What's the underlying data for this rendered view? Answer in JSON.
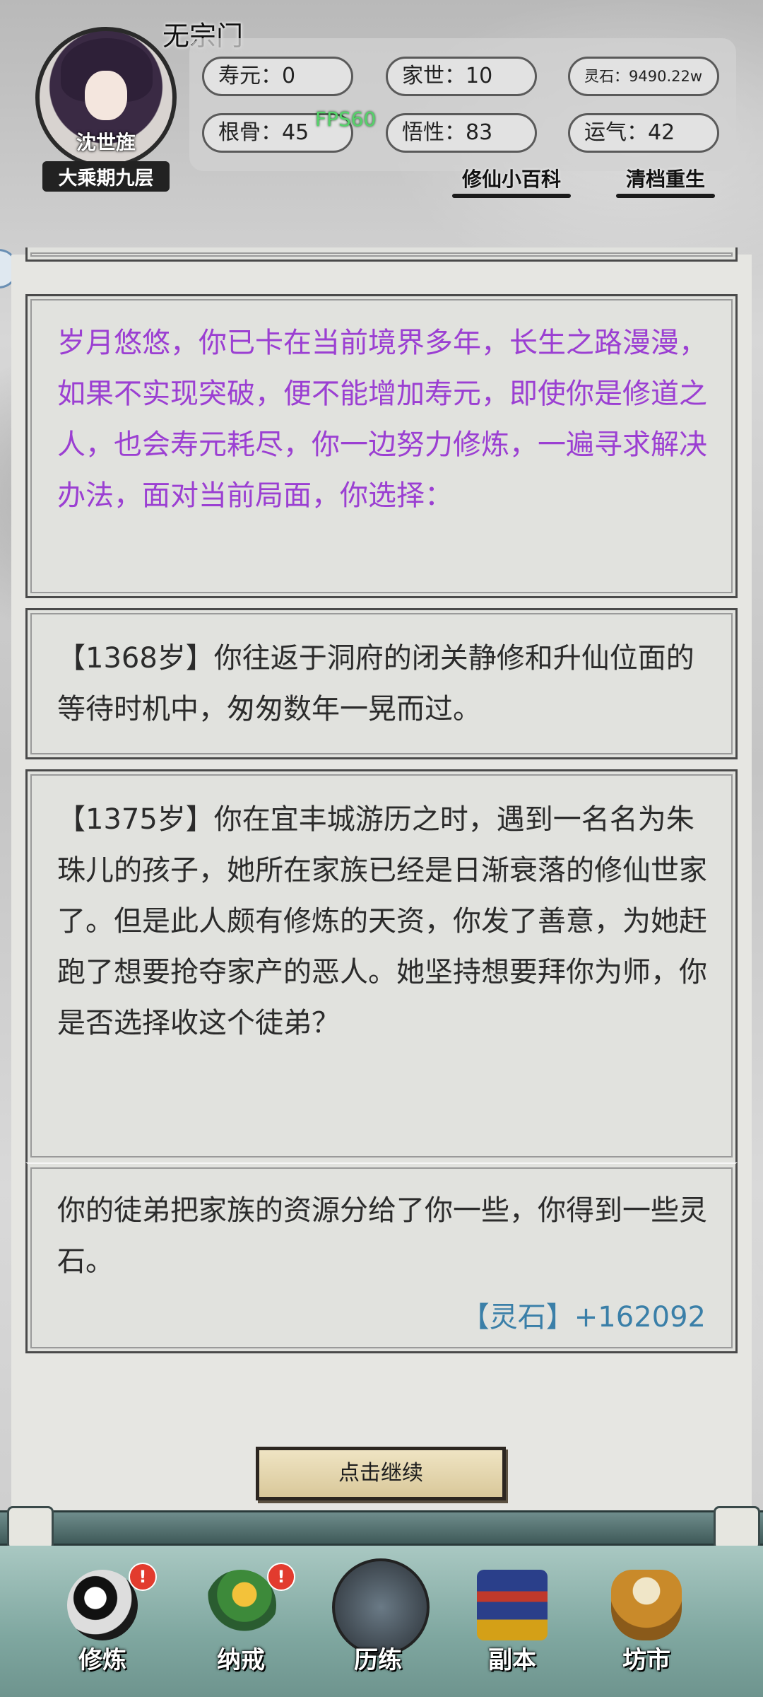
{
  "header": {
    "sect_name": "无宗门",
    "character_name": "沈世旌",
    "realm": "大乘期九层",
    "stats": {
      "lifespan": "寿元：0",
      "family": "家世：10",
      "spirit_stones": "灵石：9490.22w",
      "root_bone": "根骨：45",
      "comprehension": "悟性：83",
      "luck": "运气：42"
    },
    "links": {
      "encyclopedia": "修仙小百科",
      "rebirth": "清档重生"
    },
    "fps": "FPS60"
  },
  "log": {
    "entry1": "岁月悠悠，你已卡在当前境界多年，长生之路漫漫，如果不实现突破，便不能增加寿元，即使你是修道之人，也会寿元耗尽，你一边努力修炼，一遍寻求解决办法，面对当前局面，你选择：",
    "entry2": "【1368岁】你往返于洞府的闭关静修和升仙位面的等待时机中，匆匆数年一晃而过。",
    "entry3": "【1375岁】你在宜丰城游历之时，遇到一名名为朱珠儿的孩子，她所在家族已经是日渐衰落的修仙世家了。但是此人颇有修炼的天资，你发了善意，为她赶跑了想要抢夺家产的恶人。她坚持想要拜你为师，你是否选择收这个徒弟？",
    "entry3_result": "你的徒弟把家族的资源分给了你一些，你得到一些灵石。",
    "entry3_reward": "【灵石】+162092"
  },
  "continue_label": "点击继续",
  "nav": [
    {
      "label": "修炼",
      "icon": "taiji-icon",
      "alert": "!"
    },
    {
      "label": "纳戒",
      "icon": "ring-icon",
      "alert": "!"
    },
    {
      "label": "历练",
      "icon": "mountain-icon"
    },
    {
      "label": "副本",
      "icon": "pagoda-icon"
    },
    {
      "label": "坊市",
      "icon": "cauldron-icon"
    }
  ],
  "colors": {
    "story_text": "#9b3fd2",
    "reward_text": "#3a7fa8",
    "alert": "#e23b2e"
  }
}
